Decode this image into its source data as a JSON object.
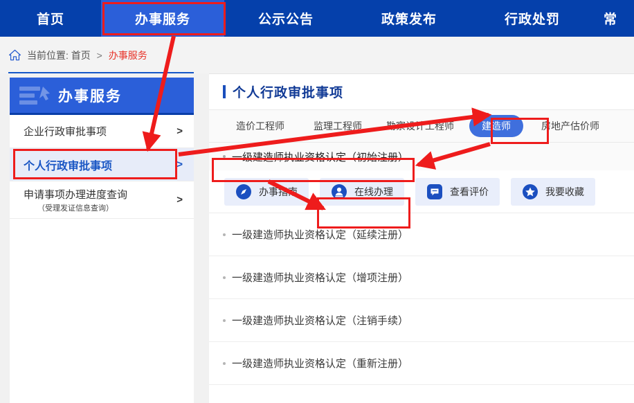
{
  "topnav": {
    "items": [
      {
        "label": "首页",
        "state": "normal"
      },
      {
        "label": "办事服务",
        "state": "active"
      },
      {
        "label": "公示公告",
        "state": "normal"
      },
      {
        "label": "政策发布",
        "state": "normal"
      },
      {
        "label": "行政处罚",
        "state": "normal"
      },
      {
        "label": "常",
        "state": "clipped"
      }
    ]
  },
  "breadcrumb": {
    "home_icon": "home-icon",
    "prefix": "当前位置:",
    "root": "首页",
    "separator": ">",
    "current": "办事服务"
  },
  "sidebar": {
    "header": {
      "title": "办事服务",
      "icon": "document-pin-icon"
    },
    "items": [
      {
        "label": "企业行政审批事项",
        "chevron": ">",
        "sub": "",
        "active": false
      },
      {
        "label": "个人行政审批事项",
        "chevron": ">",
        "sub": "",
        "active": true
      },
      {
        "label": "申请事项办理进度查询",
        "chevron": ">",
        "sub": "（受理发证信息查询）",
        "active": false
      }
    ]
  },
  "main": {
    "title": "个人行政审批事项",
    "tabs": [
      {
        "label": "造价工程师",
        "active": false
      },
      {
        "label": "监理工程师",
        "active": false
      },
      {
        "label": "勘察设计工程师",
        "active": false
      },
      {
        "label": "建造师",
        "active": true
      },
      {
        "label": "房地产估价师",
        "active": false
      }
    ],
    "selected_item": "一级建造师执业资格认定（初始注册）",
    "actions": [
      {
        "label": "办事指南",
        "icon": "compass-icon"
      },
      {
        "label": "在线办理",
        "icon": "person-icon"
      },
      {
        "label": "查看评价",
        "icon": "comment-icon"
      },
      {
        "label": "我要收藏",
        "icon": "star-icon"
      }
    ],
    "list": [
      {
        "label": "一级建造师执业资格认定（延续注册）"
      },
      {
        "label": "一级建造师执业资格认定（增项注册）"
      },
      {
        "label": "一级建造师执业资格认定（注销手续）"
      },
      {
        "label": "一级建造师执业资格认定（重新注册）"
      }
    ]
  },
  "colors": {
    "nav_bg": "#0540ab",
    "nav_active": "#2b5fd9",
    "accent_blue": "#1a56c4",
    "annotation_red": "#ee1c1c",
    "breadcrumb_current": "#e8342a",
    "action_chip": "#e9eefb"
  }
}
